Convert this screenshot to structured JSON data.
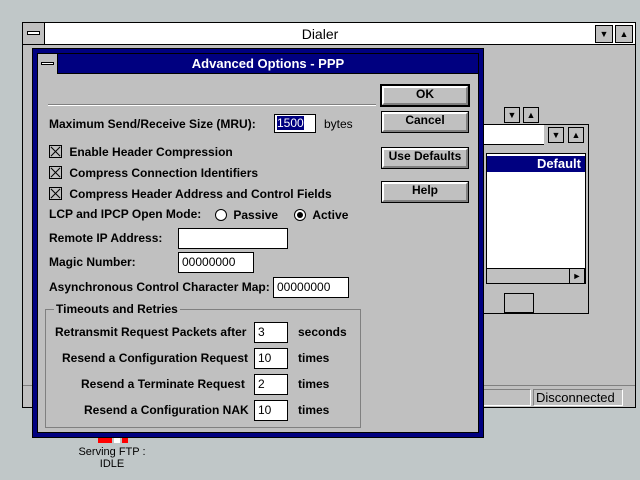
{
  "dialer": {
    "title": "Dialer",
    "status": "Disconnected"
  },
  "background_list": {
    "selected_item": "Default"
  },
  "desktop_icon": {
    "label_line1": "Serving FTP :",
    "label_line2": "IDLE"
  },
  "dialog": {
    "title": "Advanced Options - PPP",
    "mru_label": "Maximum Send/Receive Size (MRU):",
    "mru_value": "1500",
    "mru_unit": "bytes",
    "enable_header_compression": "Enable Header Compression",
    "compress_connection_ids": "Compress Connection Identifiers",
    "compress_header_address": "Compress Header Address and Control Fields",
    "open_mode_label": "LCP and IPCP Open Mode:",
    "passive_label": "Passive",
    "active_label": "Active",
    "remote_ip_label": "Remote IP Address:",
    "remote_ip_value": "",
    "magic_label": "Magic Number:",
    "magic_value": "00000000",
    "accm_label": "Asynchronous Control Character Map:",
    "accm_value": "00000000",
    "timeouts_title": "Timeouts and Retries",
    "retransmit_label": "Retransmit Request Packets after",
    "retransmit_value": "3",
    "retransmit_unit": "seconds",
    "resend_config_label": "Resend a Configuration Request",
    "resend_config_value": "10",
    "resend_config_unit": "times",
    "resend_terminate_label": "Resend a Terminate Request",
    "resend_terminate_value": "2",
    "resend_terminate_unit": "times",
    "resend_nak_label": "Resend a Configuration NAK",
    "resend_nak_value": "10",
    "resend_nak_unit": "times",
    "ok_label": "OK",
    "cancel_label": "Cancel",
    "use_defaults_label": "Use Defaults",
    "help_label": "Help"
  }
}
